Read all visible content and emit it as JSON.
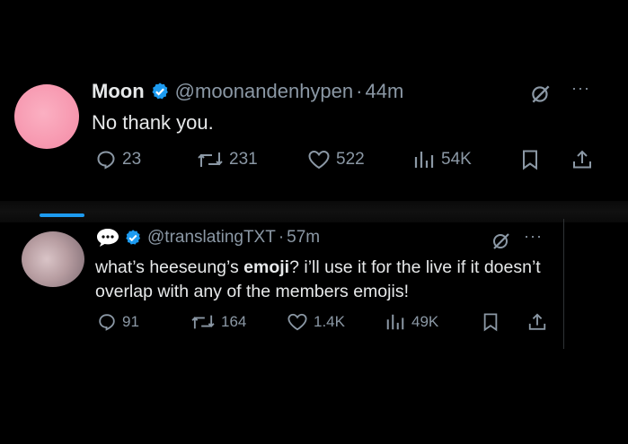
{
  "tweet1": {
    "name": "Moon",
    "handle": "@moonandenhypen",
    "separator": "·",
    "time": "44m",
    "text": "No thank you.",
    "replies": "23",
    "reposts": "231",
    "likes": "522",
    "views": "54K",
    "more": "···"
  },
  "tweet2": {
    "handle": "@translatingTXT",
    "separator": "·",
    "time": "57m",
    "text_part1": "what’s heeseung’s ",
    "text_bold": "emoji",
    "text_part2": "? i’ll use it for the live if it doesn’t overlap with any of the members emojis!",
    "replies": "91",
    "reposts": "164",
    "likes": "1.4K",
    "views": "49K",
    "more": "···"
  },
  "colors": {
    "background": "#000000",
    "text": "#e7e9ea",
    "secondary": "#8b98a5",
    "verified": "#1d9bf0",
    "avatar_pink": "#f48aa5"
  },
  "icons": [
    "verified-badge-icon",
    "grok-icon",
    "more-icon",
    "reply-icon",
    "repost-icon",
    "like-icon",
    "views-icon",
    "bookmark-icon",
    "share-icon",
    "speech-bubble-icon"
  ]
}
